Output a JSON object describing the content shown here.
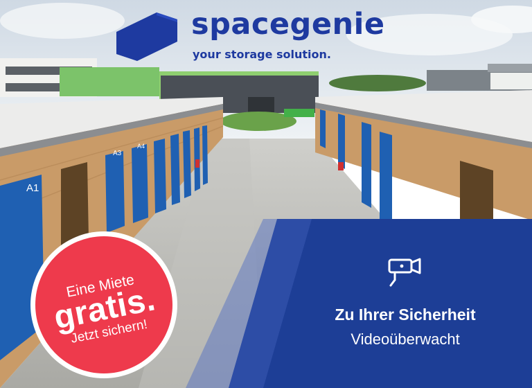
{
  "brand": {
    "name": "spacegenie",
    "tagline": "your storage solution.",
    "color": "#1e3aa0"
  },
  "promo_badge": {
    "line1": "Eine Miete",
    "line2": "gratis.",
    "line3": "Jetzt sichern!",
    "color": "#ee3a4c"
  },
  "security_panel": {
    "icon": "security-camera-icon",
    "title": "Zu Ihrer Sicherheit",
    "subtitle": "Videoüberwacht",
    "color": "#1d3e96"
  },
  "photo": {
    "left_unit_labels": [
      "A1",
      "A3",
      "A4"
    ]
  }
}
